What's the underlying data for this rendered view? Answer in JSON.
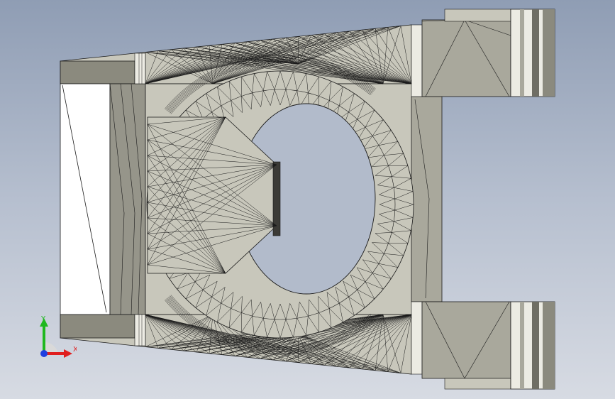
{
  "viewport": {
    "background_top": "#8f9db4",
    "background_bottom": "#d7dbe3"
  },
  "model": {
    "face_color": "#c8c7bb",
    "face_dark": "#8b8a7e",
    "face_mid": "#a9a89c",
    "face_light": "#ecebe3",
    "edge_color": "#1a1a1a"
  },
  "triad": {
    "x_label": "X",
    "y_label": "Y",
    "x_color": "#e01e1e",
    "y_color": "#1fb81f",
    "z_color": "#1e3ee0"
  }
}
